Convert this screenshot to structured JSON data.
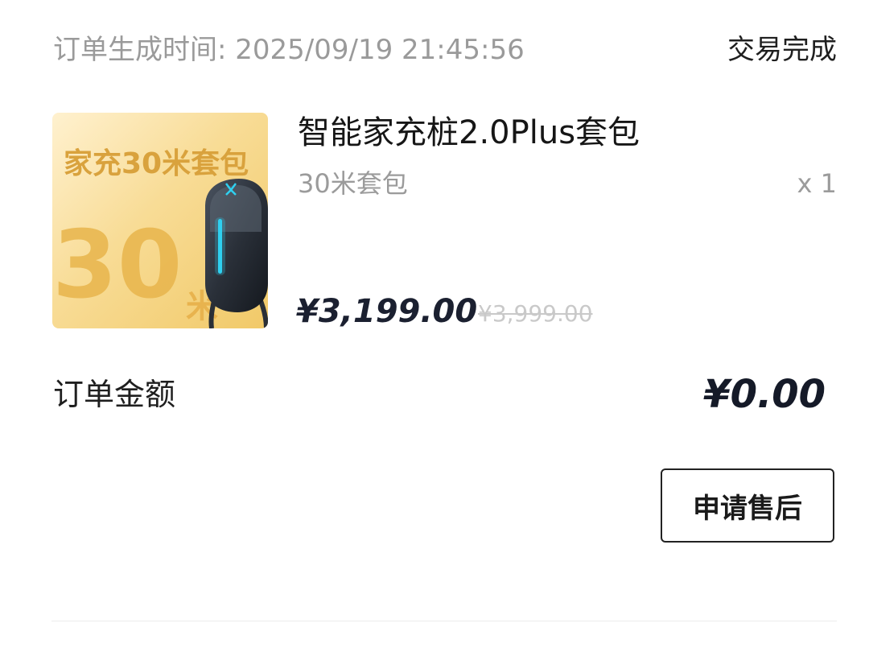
{
  "order": {
    "time_label": "订单生成时间: 2025/09/19 21:45:56",
    "status": "交易完成"
  },
  "product": {
    "image": {
      "title": "家充30米套包",
      "big_number": "30",
      "unit": "米",
      "icon": "wall-charger-icon"
    },
    "name": "智能家充桩2.0Plus套包",
    "spec": "30米套包",
    "quantity": "x 1",
    "price": "¥3,199.00",
    "original_price": "¥3,999.00"
  },
  "summary": {
    "amount_label": "订单金额",
    "amount_value": "¥0.00"
  },
  "actions": {
    "after_sale_label": "申请售后"
  },
  "colors": {
    "accent_gold": "#e8b54c",
    "price_dark": "#1b2030",
    "charger_glow": "#2fd0f0"
  }
}
